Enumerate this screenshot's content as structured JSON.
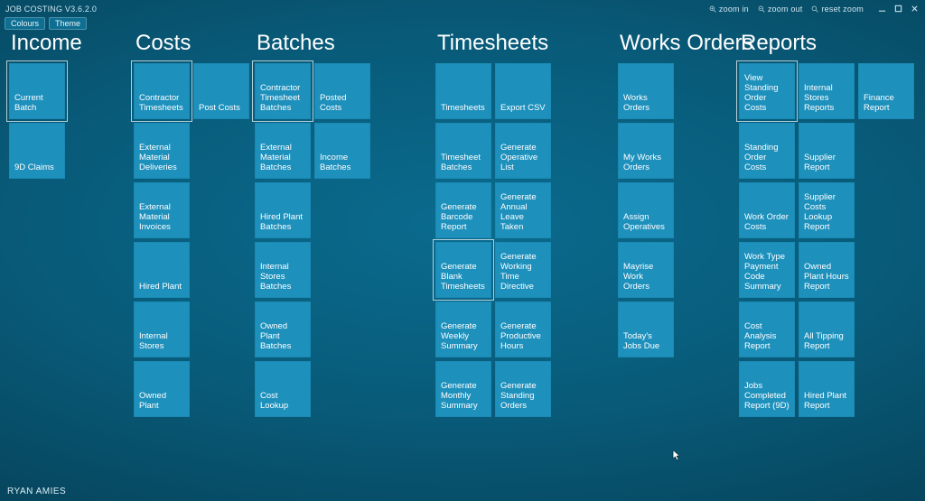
{
  "app_title": "JOB COSTING V3.6.2.0",
  "toolbar": {
    "colours": "Colours",
    "theme": "Theme",
    "zoom_in": "zoom in",
    "zoom_out": "zoom out",
    "reset_zoom": "reset zoom"
  },
  "username": "RYAN AMIES",
  "columns": {
    "income": {
      "title": "Income"
    },
    "costs": {
      "title": "Costs"
    },
    "batches": {
      "title": "Batches"
    },
    "timesheets": {
      "title": "Timesheets"
    },
    "works": {
      "title": "Works Orders"
    },
    "reports": {
      "title": "Reports"
    }
  },
  "tiles": {
    "income_current_batch": "Current Batch",
    "income_9d_claims": "9D Claims",
    "costs_contractor_timesheets": "Contractor Timesheets",
    "costs_post_costs": "Post Costs",
    "costs_ext_mat_deliveries": "External Material Deliveries",
    "costs_ext_mat_invoices": "External Material Invoices",
    "costs_hired_plant": "Hired Plant",
    "costs_internal_stores": "Internal Stores",
    "costs_owned_plant": "Owned Plant",
    "batches_contractor_timesheet": "Contractor Timesheet Batches",
    "batches_posted_costs": "Posted Costs",
    "batches_ext_mat": "External Material Batches",
    "batches_income": "Income Batches",
    "batches_hired_plant": "Hired Plant Batches",
    "batches_internal_stores": "Internal Stores Batches",
    "batches_owned_plant": "Owned Plant Batches",
    "batches_cost_lookup": "Cost Lookup",
    "ts_timesheets": "Timesheets",
    "ts_export_csv": "Export CSV",
    "ts_batches": "Timesheet Batches",
    "ts_gen_op_list": "Generate Operative List",
    "ts_gen_barcode": "Generate Barcode Report",
    "ts_gen_annual_leave": "Generate Annual Leave Taken",
    "ts_gen_blank": "Generate Blank Timesheets",
    "ts_gen_wtd": "Generate Working Time Directive",
    "ts_gen_weekly": "Generate Weekly Summary",
    "ts_gen_productive": "Generate Productive Hours",
    "ts_gen_monthly": "Generate Monthly Summary",
    "ts_gen_standing": "Generate Standing Orders",
    "wo_works_orders": "Works Orders",
    "wo_my": "My Works Orders",
    "wo_assign": "Assign Operatives",
    "wo_mayrise": "Mayrise Work Orders",
    "wo_today": "Today's Jobs Due",
    "rp_view_standing": "View Standing Order Costs",
    "rp_internal_stores": "Internal Stores Reports",
    "rp_finance": "Finance Report",
    "rp_standing_costs": "Standing Order Costs",
    "rp_supplier": "Supplier Report",
    "rp_wo_costs": "Work Order Costs",
    "rp_supplier_lookup": "Supplier Costs Lookup Report",
    "rp_work_type": "Work Type Payment Code Summary",
    "rp_owned_plant_hours": "Owned Plant Hours Report",
    "rp_cost_analysis": "Cost Analysis Report",
    "rp_all_tipping": "All Tipping Report",
    "rp_jobs_completed": "Jobs Completed Report (9D)",
    "rp_hired_plant": "Hired Plant Report"
  }
}
